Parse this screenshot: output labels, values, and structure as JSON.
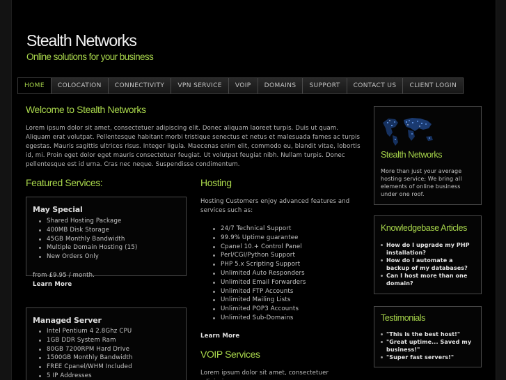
{
  "header": {
    "title": "Stealth Networks",
    "tagline": "Online solutions for your business"
  },
  "nav": {
    "items": [
      "HOME",
      "COLOCATION",
      "CONNECTIVITY",
      "VPN SERVICE",
      "VOIP",
      "DOMAINS",
      "SUPPORT",
      "CONTACT US",
      "CLIENT LOGIN"
    ],
    "active": "HOME"
  },
  "welcome": {
    "heading": "Welcome to Stealth Networks",
    "body": "Lorem ipsum dolor sit amet, consectetuer adipiscing elit. Donec aliquam laoreet turpis. Duis ut quam. Aliquam erat volutpat. Pellentesque habitant morbi tristique senectus et netus et malesuada fames ac turpis egestas. Mauris sagittis ultrices risus. Integer ligula. Maecenas enim elit, commodo eu, blandit vitae, lobortis id, mi. Proin eget dolor eget mauris consectetuer feugiat. Ut volutpat feugiat nibh. Nullam turpis. Donec pellentesque est id urna. Cras nec neque. Suspendisse condimentum."
  },
  "featured": {
    "heading": "Featured Services:",
    "may_special": {
      "title": "May Special",
      "items": [
        "Shared Hosting Package",
        "400MB Disk Storage",
        "45GB Monthly Bandwidth",
        "Multiple Domain Hosting (15)",
        "New Orders Only"
      ],
      "price": "from £9.95 / month.",
      "more": "Learn More"
    },
    "managed": {
      "title": "Managed Server",
      "items": [
        "Intel Pentium 4 2.8Ghz CPU",
        "1GB DDR System Ram",
        "80GB 7200RPM Hard Drive",
        "1500GB Monthly Bandwidth",
        "FREE Cpanel/WHM Included",
        "5 IP Addresses"
      ]
    }
  },
  "hosting": {
    "heading": "Hosting",
    "intro": "Hosting Customers enjoy advanced features and services such as:",
    "items": [
      "24/7 Technical Support",
      "99.9% Uptime guarantee",
      "Cpanel 10.+ Control Panel",
      "Perl/CGI/Python Support",
      "PHP 5.x Scripting Support",
      "Unlimited Auto Responders",
      "Unlimited Email Forwarders",
      "Unlimited FTP Accounts",
      "Unlimited Mailing Lists",
      "Unlimited POP3 Accounts",
      "Unlimited Sub-Domains"
    ],
    "more": "Learn More"
  },
  "voip": {
    "heading": "VOIP Services",
    "body": "Lorem ipsum dolor sit amet, consectetuer adipiscing"
  },
  "sidebar": {
    "about": {
      "title": "Stealth Networks",
      "body": "More than just your average hosting service; We bring all elements of online business under one roof."
    },
    "kb": {
      "title": "Knowledgebase Articles",
      "items": [
        "How do I upgrade my PHP installation?",
        "How do I automate a backup of my databases?",
        "Can I host more than one domain?"
      ]
    },
    "testimonials": {
      "title": "Testimonials",
      "items": [
        "\"This is the best host!\"",
        "\"Great uptime... Saved my business!\"",
        "\"Super fast servers!\""
      ]
    }
  },
  "colors": {
    "accent": "#a8d64b",
    "background": "#000000",
    "text": "#c8c8c8"
  }
}
